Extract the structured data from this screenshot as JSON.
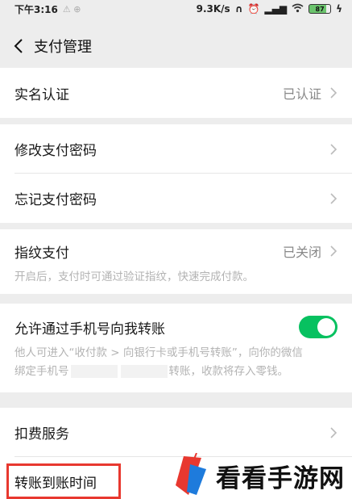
{
  "status_bar": {
    "time": "下午3:16",
    "speed": "9.3K/s",
    "battery": "87"
  },
  "header": {
    "title": "支付管理"
  },
  "rows": {
    "real_name": {
      "label": "实名认证",
      "value": "已认证"
    },
    "change_password": {
      "label": "修改支付密码"
    },
    "forgot_password": {
      "label": "忘记支付密码"
    },
    "fingerprint": {
      "label": "指纹支付",
      "value": "已关闭",
      "description": "开启后，支付时可通过验证指纹，快速完成付款。"
    },
    "phone_transfer": {
      "label": "允许通过手机号向我转账",
      "enabled": true,
      "description_line1": "他人可进入“收付款 > 向银行卡或手机号转账”，向你的微信",
      "description_line2_start": "绑定手机号",
      "description_line2_end": "转账，收款将存入零钱。"
    },
    "deduction_service": {
      "label": "扣费服务"
    },
    "transfer_time": {
      "label": "转账到账时间"
    }
  },
  "watermark": {
    "text": "看看手游网"
  },
  "colors": {
    "accent_green": "#07c160",
    "highlight_red": "#e8382f"
  }
}
